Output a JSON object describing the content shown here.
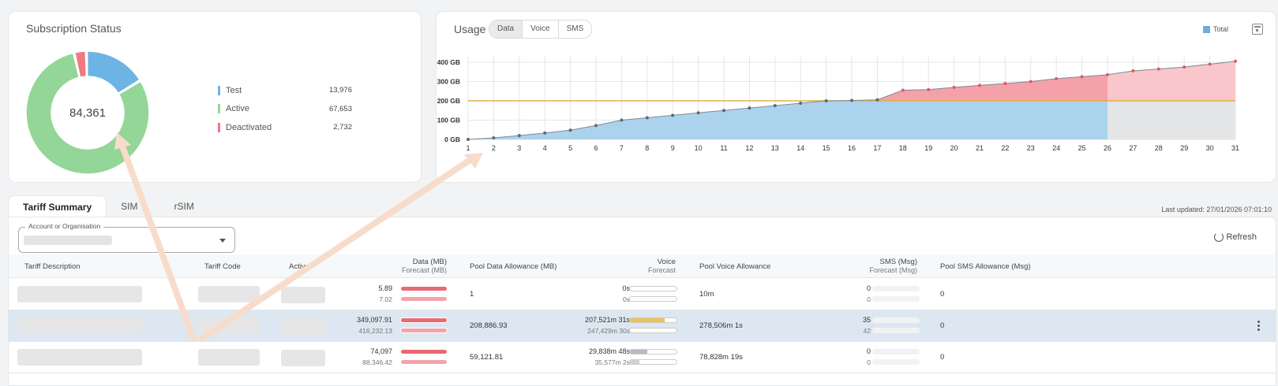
{
  "subscription_status": {
    "title": "Subscription Status",
    "total": "84,361",
    "legend": [
      {
        "label": "Test",
        "value": "13,976",
        "color": "#6cb4e4"
      },
      {
        "label": "Active",
        "value": "67,653",
        "color": "#93d697"
      },
      {
        "label": "Deactivated",
        "value": "2,732",
        "color": "#ef7a82"
      }
    ],
    "colors": {
      "active": "#93d697",
      "test": "#6cb4e4",
      "deactivated": "#ef7a82"
    }
  },
  "usage": {
    "title": "Usage",
    "segments": [
      {
        "label": "Data",
        "active": true
      },
      {
        "label": "Voice",
        "active": false
      },
      {
        "label": "SMS",
        "active": false
      }
    ],
    "legend_label": "Total"
  },
  "chart_data": {
    "type": "area",
    "x": [
      1,
      2,
      3,
      4,
      5,
      6,
      7,
      8,
      9,
      10,
      11,
      12,
      13,
      14,
      15,
      16,
      17,
      18,
      19,
      20,
      21,
      22,
      23,
      24,
      25,
      26,
      27,
      28,
      29,
      30,
      31
    ],
    "y_tick_labels": [
      "0 GB",
      "100 GB",
      "200 GB",
      "300 GB",
      "400 GB"
    ],
    "ylim": [
      0,
      440
    ],
    "allowance_line": 200,
    "actual_through_day": 26,
    "series": [
      {
        "name": "Total",
        "values": [
          0,
          8,
          20,
          33,
          48,
          72,
          100,
          112,
          125,
          138,
          150,
          163,
          175,
          188,
          200,
          202,
          205,
          255,
          258,
          270,
          280,
          290,
          300,
          315,
          325,
          335,
          355,
          365,
          375,
          390,
          405
        ]
      }
    ],
    "colors": {
      "under": "#acd3ed",
      "over": "#f4a1aa",
      "forecast_under": "#e3e5e7",
      "forecast_over": "#f8c6cb",
      "line": "#7e8a96",
      "allowance": "#e0b142",
      "over_point": "#e25964"
    },
    "grid": true
  },
  "tabs": [
    {
      "label": "Tariff Summary",
      "active": true
    },
    {
      "label": "SIM",
      "active": false
    },
    {
      "label": "rSIM",
      "active": false
    }
  ],
  "last_updated": "Last updated: 27/01/2026 07:01:10",
  "filters": {
    "account_label": "Account or Organisation"
  },
  "refresh_label": "Refresh",
  "table": {
    "headers": {
      "tariff_description": "Tariff Description",
      "tariff_code": "Tariff Code",
      "active": "Active",
      "data": "Data (MB)",
      "data_sub": "Forecast (MB)",
      "pool_data": "Pool Data Allowance (MB)",
      "voice": "Voice",
      "voice_sub": "Forecast",
      "pool_voice": "Pool Voice Allowance",
      "sms": "SMS (Msg)",
      "sms_sub": "Forecast (Msg)",
      "pool_sms": "Pool SMS Allowance (Msg)"
    },
    "rows": [
      {
        "data": "5.89",
        "data_forecast": "7.02",
        "data_bar": 1.0,
        "data_forecast_bar": 1.0,
        "pool_data": "1",
        "voice": "0s",
        "voice_forecast": "0s",
        "voice_bar": 0,
        "voice_forecast_bar": 0,
        "pool_voice": "10m",
        "sms": "0",
        "sms_forecast": "0",
        "pool_sms": "0",
        "selected": false
      },
      {
        "data": "349,097.91",
        "data_forecast": "416,232.13",
        "data_bar": 1.0,
        "data_forecast_bar": 1.0,
        "pool_data": "208,886.93",
        "voice": "207,521m 31s",
        "voice_forecast": "247,429m 30s",
        "voice_bar": 0.75,
        "voice_forecast_bar": 0,
        "pool_voice": "278,506m 1s",
        "sms": "35",
        "sms_forecast": "42",
        "pool_sms": "0",
        "selected": true
      },
      {
        "data": "74,097",
        "data_forecast": "88,346.42",
        "data_bar": 1.0,
        "data_forecast_bar": 1.0,
        "pool_data": "59,121.81",
        "voice": "29,838m 48s",
        "voice_forecast": "35,577m 2s",
        "voice_bar": 0.38,
        "voice_forecast_bar": 0.2,
        "pool_voice": "78,828m 19s",
        "sms": "0",
        "sms_forecast": "0",
        "pool_sms": "0",
        "selected": false
      }
    ]
  }
}
